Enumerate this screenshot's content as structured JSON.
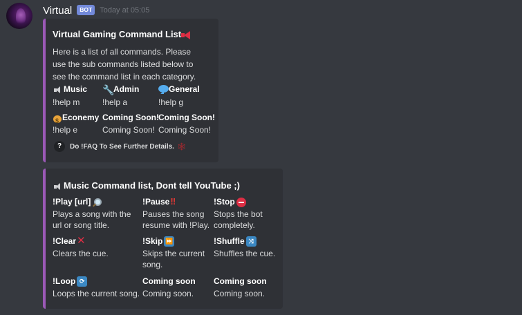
{
  "message": {
    "username": "Virtual",
    "bot_tag": "BOT",
    "timestamp": "Today at 05:05"
  },
  "embed1": {
    "title": "Virtual Gaming Command List",
    "description": "Here is a list of all commands. Please use the sub commands listed below to see the command list in each category.",
    "fields": [
      {
        "name": "Music",
        "value": "!help m",
        "icon": "speaker-icon"
      },
      {
        "name": "Admin",
        "value": "!help a",
        "icon": "wrench-icon"
      },
      {
        "name": "General",
        "value": "!help g",
        "icon": "speech-bubble-icon"
      },
      {
        "name": "Econemy",
        "value": "!help e",
        "icon": "money-bag-icon"
      },
      {
        "name": "Coming Soon!",
        "value": "Coming Soon!"
      },
      {
        "name": "Coming Soon!",
        "value": "Coming Soon!"
      }
    ],
    "footer_icon": "?",
    "footer": "Do !FAQ To See Further Details."
  },
  "embed2": {
    "title": "Music Command list, Dont tell YouTube ;)",
    "fields": [
      {
        "name": "!Play [url]",
        "value": "Plays a song with the url or song title.",
        "icon": "magnifier-icon"
      },
      {
        "name": "!Pause",
        "value": "Pauses the song resume with !Play.",
        "icon": "double-exclamation-icon"
      },
      {
        "name": "!Stop",
        "value": "Stops the bot completely.",
        "icon": "no-entry-icon"
      },
      {
        "name": "!Clear",
        "value": "Clears the cue.",
        "icon": "cross-mark-icon"
      },
      {
        "name": "!Skip",
        "value": "Skips the current song.",
        "icon": "fast-forward-icon"
      },
      {
        "name": "!Shuffle",
        "value": "Shuffles the cue.",
        "icon": "shuffle-icon"
      },
      {
        "name": "!Loop",
        "value": "Loops the current song.",
        "icon": "repeat-icon"
      },
      {
        "name": "Coming soon",
        "value": "Coming soon."
      },
      {
        "name": "Coming soon",
        "value": "Coming soon."
      }
    ]
  },
  "colors": {
    "background": "#36393f",
    "embed_background": "#2f3136",
    "embed_accent": "#9b59b6",
    "bot_tag": "#7289da"
  }
}
